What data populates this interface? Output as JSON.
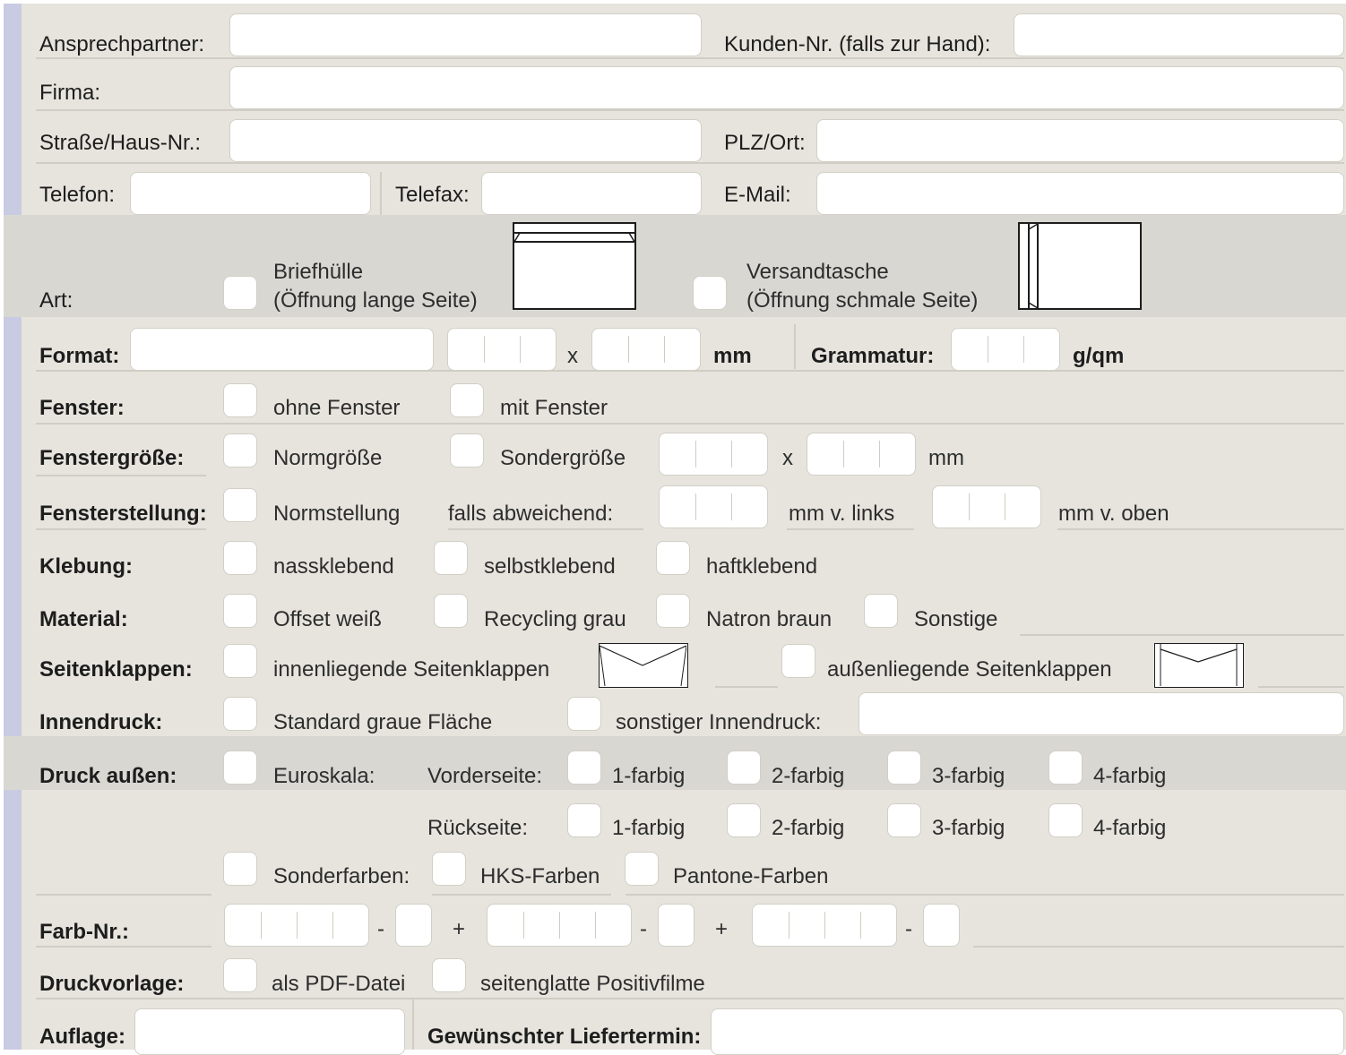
{
  "contact": {
    "ansprechpartner": "Ansprechpartner:",
    "kunden_nr": "Kunden-Nr. (falls zur Hand):",
    "firma": "Firma:",
    "strasse": "Straße/Haus-Nr.:",
    "plz_ort": "PLZ/Ort:",
    "telefon": "Telefon:",
    "telefax": "Telefax:",
    "email": "E-Mail:"
  },
  "art": {
    "label": "Art:",
    "option1_line1": "Briefhülle",
    "option1_line2": "(Öffnung lange Seite)",
    "option2_line1": "Versandtasche",
    "option2_line2": "(Öffnung schmale Seite)"
  },
  "format": {
    "label": "Format:",
    "x": "x",
    "mm": "mm",
    "grammatur": "Grammatur:",
    "unit": "g/qm"
  },
  "fenster": {
    "label": "Fenster:",
    "ohne": "ohne Fenster",
    "mit": "mit Fenster"
  },
  "fenstergroesse": {
    "label": "Fenstergröße:",
    "norm": "Normgröße",
    "sonder": "Sondergröße",
    "x": "x",
    "mm": "mm"
  },
  "fensterstellung": {
    "label": "Fensterstellung:",
    "norm": "Normstellung",
    "abweichend": "falls abweichend:",
    "links": "mm v. links",
    "oben": "mm v. oben"
  },
  "klebung": {
    "label": "Klebung:",
    "nass": "nassklebend",
    "selbst": "selbstklebend",
    "haft": "haftklebend"
  },
  "material": {
    "label": "Material:",
    "offset": "Offset weiß",
    "recycling": "Recycling grau",
    "natron": "Natron braun",
    "sonstige": "Sonstige"
  },
  "seitenklappen": {
    "label": "Seitenklappen:",
    "innen": "innenliegende Seitenklappen",
    "aussen": "außenliegende Seitenklappen"
  },
  "innendruck": {
    "label": "Innendruck:",
    "standard": "Standard graue Fläche",
    "sonstiger": "sonstiger Innendruck:"
  },
  "druck": {
    "label": "Druck außen:",
    "euroskala": "Euroskala:",
    "vorderseite": "Vorderseite:",
    "rueckseite": "Rückseite:",
    "f1": "1-farbig",
    "f2": "2-farbig",
    "f3": "3-farbig",
    "f4": "4-farbig",
    "sonderfarben": "Sonderfarben:",
    "hks": "HKS-Farben",
    "pantone": "Pantone-Farben"
  },
  "farbnr": {
    "label": "Farb-Nr.:",
    "dash": "-",
    "plus": "+"
  },
  "druckvorlage": {
    "label": "Druckvorlage:",
    "pdf": "als PDF-Datei",
    "film": "seitenglatte Positivfilme"
  },
  "auflage": {
    "label": "Auflage:",
    "liefertermin": "Gewünschter Liefertermin:"
  }
}
